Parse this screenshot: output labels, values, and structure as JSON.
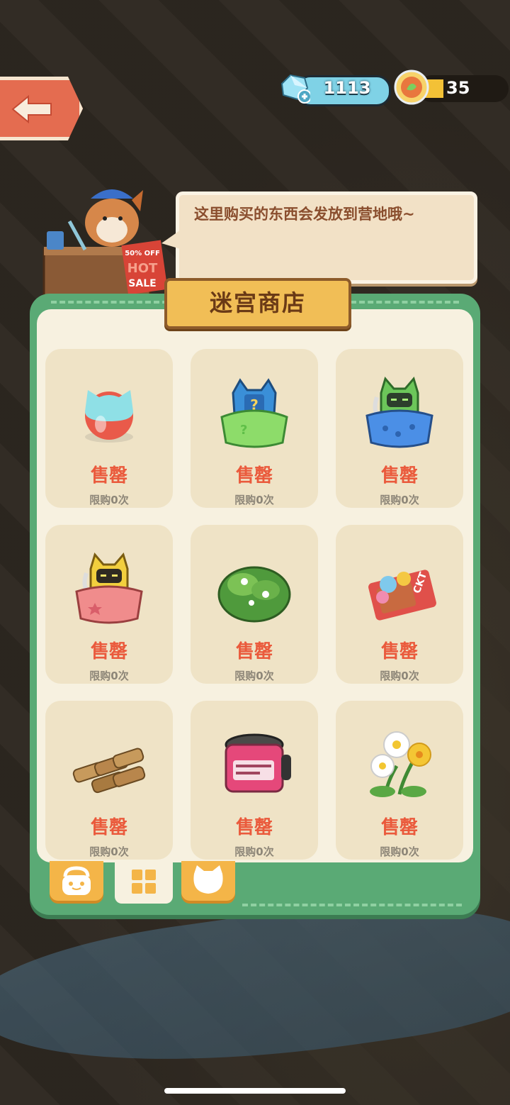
{
  "currency": {
    "gems": "1113",
    "coins": "35"
  },
  "merchant": {
    "speech": "这里购买的东西会发放到营地哦~",
    "sign_discount": "50% OFF",
    "sign_hot": "HOT",
    "sign_sale": "SALE"
  },
  "shop": {
    "title": "迷宫商店",
    "items": [
      {
        "icon": "crystal-cat-ball-icon",
        "status": "售罄",
        "limit": "限购0次"
      },
      {
        "icon": "mystery-blue-bag-icon",
        "status": "售罄",
        "limit": "限购0次"
      },
      {
        "icon": "green-robot-cat-bag-icon",
        "status": "售罄",
        "limit": "限购0次"
      },
      {
        "icon": "yellow-robot-cat-bag-icon",
        "status": "售罄",
        "limit": "限购0次"
      },
      {
        "icon": "flower-bush-icon",
        "status": "售罄",
        "limit": "限购0次"
      },
      {
        "icon": "ticket-bundle-icon",
        "status": "售罄",
        "limit": "限购0次"
      },
      {
        "icon": "wood-logs-icon",
        "status": "售罄",
        "limit": "限购0次"
      },
      {
        "icon": "jam-jar-icon",
        "status": "售罄",
        "limit": "限购0次"
      },
      {
        "icon": "daisy-flowers-icon",
        "status": "售罄",
        "limit": "限购0次"
      }
    ]
  },
  "tabs": [
    {
      "icon": "bag-icon",
      "active": false
    },
    {
      "icon": "grid-icon",
      "active": true
    },
    {
      "icon": "cat-icon",
      "active": false
    }
  ],
  "colors": {
    "panel_green": "#5aaa75",
    "sold_out_red": "#ea5a3c",
    "tab_orange": "#f4b548"
  }
}
